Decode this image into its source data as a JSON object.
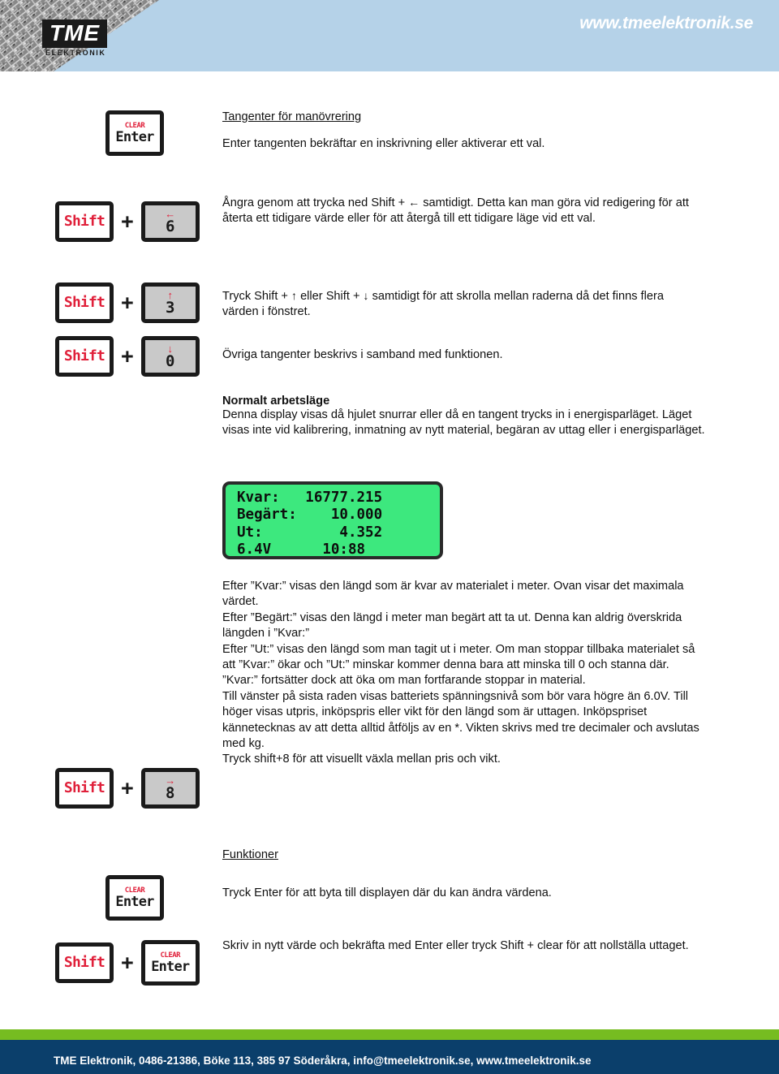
{
  "header": {
    "logo_text": "TME",
    "logo_subtitle": "ELEKTRONIK",
    "site_url": "www.tmeelektronik.se"
  },
  "sections": {
    "keys_heading": "Tangenter för manövrering",
    "enter_desc": "Enter tangenten bekräftar en inskrivning eller aktiverar ett val.",
    "undo_desc_a": "Ångra genom att trycka ned Shift + ",
    "undo_arrow": "←",
    "undo_desc_b": " samtidigt. Detta kan man göra vid redigering för att återta ett tidigare värde eller för att återgå till ett tidigare läge vid ett val.",
    "scroll_desc_a": "Tryck Shift + ",
    "scroll_arrow_up": "↑",
    "scroll_desc_b": " eller Shift + ",
    "scroll_arrow_down": "↓",
    "scroll_desc_c": " samtidigt för att skrolla mellan raderna då det finns flera värden i fönstret.",
    "other_keys_desc": "Övriga tangenter beskrivs i samband med funktionen.",
    "normal_mode_heading": "Normalt arbetsläge",
    "normal_mode_desc": "Denna display visas då hjulet snurrar eller då en tangent trycks in i energisparläget. Läget visas inte vid kalibrering, inmatning av nytt material, begäran av uttag eller i energisparläget.",
    "display_desc": "Efter ”Kvar:” visas den längd som är kvar av materialet i meter. Ovan visar det maximala värdet.\nEfter ”Begärt:” visas den längd i meter man begärt att ta ut. Denna kan aldrig överskrida längden i ”Kvar:”\nEfter ”Ut:” visas den längd som man tagit ut i meter. Om man stoppar tillbaka materialet så att ”Kvar:” ökar och ”Ut:” minskar kommer denna bara att minska till 0 och stanna där. ”Kvar:” fortsätter dock att öka om man fortfarande stoppar in material.\nTill vänster på sista raden visas batteriets spänningsnivå som bör vara högre än 6.0V. Till höger visas utpris, inköpspris eller vikt för den längd som är uttagen. Inköpspriset kännetecknas av att detta alltid åtföljs av en *. Vikten skrivs med tre decimaler och avslutas med kg.\nTryck shift+8 för att visuellt växla mellan pris och vikt.",
    "functions_heading": "Funktioner",
    "functions_enter_desc": "Tryck Enter för att byta till displayen där du kan ändra värdena.",
    "functions_shift_clear_desc": "Skriv in nytt värde och bekräfta med Enter eller tryck Shift + clear för att nollställa uttaget."
  },
  "keys": {
    "clear_label": "CLEAR",
    "enter_label": "Enter",
    "shift_label": "Shift",
    "digit_6": "6",
    "digit_3": "3",
    "digit_0": "0",
    "digit_8": "8",
    "arrow_left": "←",
    "arrow_up": "↑",
    "arrow_down": "↓",
    "arrow_right": "→",
    "plus": "+"
  },
  "lcd": {
    "line1": "Kvar:   16777.215",
    "line2": "Begärt:    10.000",
    "line3": "Ut:         4.352",
    "line4": "6.4V      10:88"
  },
  "footer": {
    "contact": "TME Elektronik, 0486-21386, Böke 113, 385 97 Söderåkra, info@tmeelektronik.se, www.tmeelektronik.se"
  },
  "colors": {
    "header_blue": "#b5d2e8",
    "footer_navy": "#0b3f6b",
    "accent_green": "#76bc21",
    "lcd_green": "#3de87e",
    "key_red": "#e0203a"
  }
}
